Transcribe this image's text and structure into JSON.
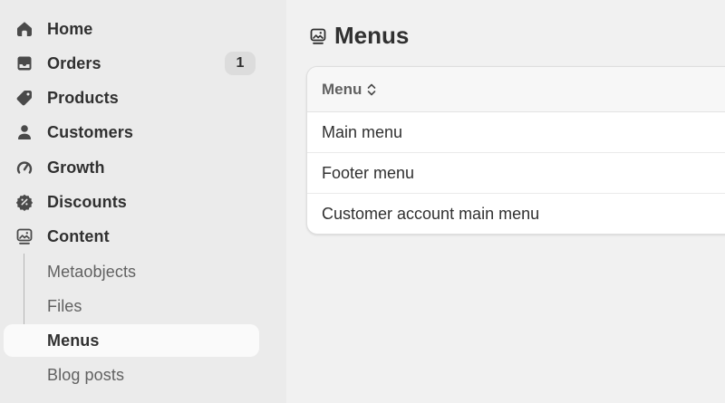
{
  "sidebar": {
    "items": [
      {
        "label": "Home",
        "icon": "home-icon"
      },
      {
        "label": "Orders",
        "icon": "inbox-icon",
        "badge": "1"
      },
      {
        "label": "Products",
        "icon": "tag-icon"
      },
      {
        "label": "Customers",
        "icon": "person-icon"
      },
      {
        "label": "Growth",
        "icon": "gauge-icon"
      },
      {
        "label": "Discounts",
        "icon": "discount-badge-icon"
      },
      {
        "label": "Content",
        "icon": "image-icon"
      }
    ],
    "subitems": [
      {
        "label": "Metaobjects"
      },
      {
        "label": "Files"
      },
      {
        "label": "Menus",
        "active": true
      },
      {
        "label": "Blog posts"
      }
    ]
  },
  "main": {
    "title": "Menus",
    "title_icon": "image-icon",
    "table": {
      "header": "Menu",
      "rows": [
        "Main menu",
        "Footer menu",
        "Customer account main menu"
      ]
    }
  },
  "colors": {
    "sidebar_bg": "#ebebeb",
    "page_bg": "#f1f1f1",
    "active_bg": "#fafafa",
    "text": "#303030",
    "muted_text": "#616161"
  }
}
